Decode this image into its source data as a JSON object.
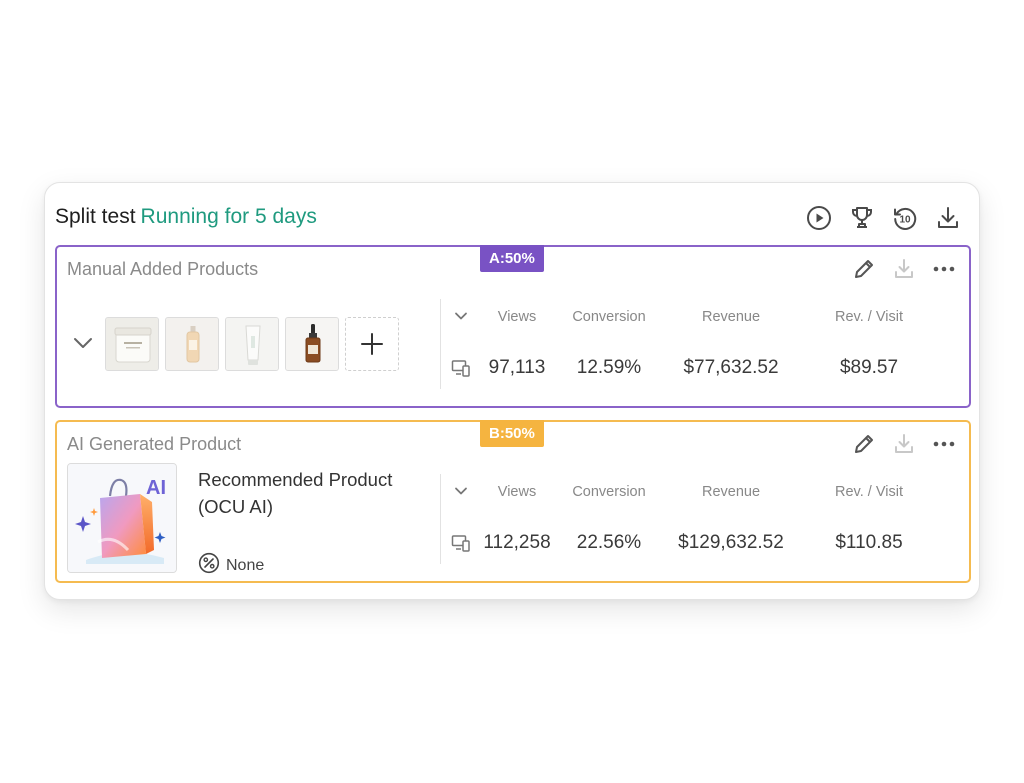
{
  "header": {
    "title": "Split test",
    "status": "Running for 5 days",
    "icons": [
      "play-icon",
      "trophy-icon",
      "history-icon",
      "download-icon"
    ]
  },
  "variant_a": {
    "label": "Manual Added Products",
    "badge": "A:50%",
    "actions": [
      "edit-icon",
      "download-icon",
      "more-icon"
    ],
    "product_thumbnails": [
      "cream-jar",
      "oil-bottle",
      "cream-tube",
      "serum-dropper"
    ],
    "stats": {
      "headers": [
        "Views",
        "Conversion",
        "Revenue",
        "Rev. / Visit"
      ],
      "values": [
        "97,113",
        "12.59%",
        "$77,632.52",
        "$89.57"
      ]
    }
  },
  "variant_b": {
    "label": "AI Generated Product",
    "badge": "B:50%",
    "actions": [
      "edit-icon",
      "download-icon",
      "more-icon"
    ],
    "product_name": "Recommended Product (OCU AI)",
    "image_text": "AI",
    "discount": "None",
    "stats": {
      "headers": [
        "Views",
        "Conversion",
        "Revenue",
        "Rev. / Visit"
      ],
      "values": [
        "112,258",
        "22.56%",
        "$129,632.52",
        "$110.85"
      ]
    }
  },
  "colors": {
    "running": "#1f9a7f",
    "variant_a": "#7952c4",
    "variant_b": "#f5b440"
  }
}
